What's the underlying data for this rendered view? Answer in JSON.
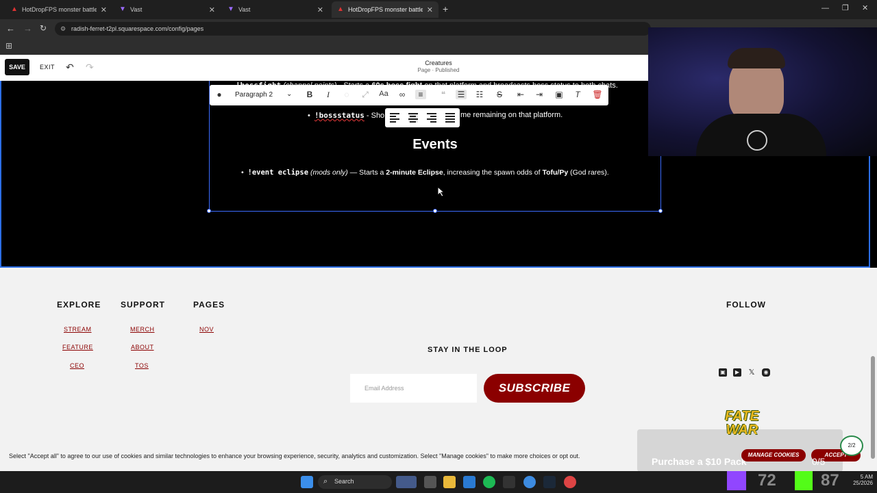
{
  "browser": {
    "tabs": [
      {
        "title": "HotDropFPS monster battle sty",
        "favicon": "squarespace-icon",
        "active": false
      },
      {
        "title": "Vast",
        "favicon": "vast-icon",
        "active": false
      },
      {
        "title": "Vast",
        "favicon": "vast-icon",
        "active": false
      },
      {
        "title": "HotDropFPS monster battle sty",
        "favicon": "squarespace-icon",
        "active": true
      }
    ],
    "url": "radish-ferret-t2pl.squarespace.com/config/pages"
  },
  "editor": {
    "save_label": "SAVE",
    "exit_label": "EXIT",
    "page_title": "Creatures",
    "page_status": "Page · Published"
  },
  "format_toolbar": {
    "style_select": "Paragraph 2"
  },
  "content": {
    "line1_cmd": "!bossfight",
    "line1_paren": "(channel points)",
    "line1_mid": " - Starts a ",
    "line1_bold": "60s boss fight",
    "line1_rest": " on that platform and broadcasts boss status to both chats.",
    "line2_cmd": "!bossstatus",
    "line2_a": " - Sho",
    "line2_b": "me remaining on that platform.",
    "events_heading": "Events",
    "event_cmd": "!event eclipse",
    "event_paren": "(mods only)",
    "event_mid": " — Starts a ",
    "event_bold1": "2-minute Eclipse",
    "event_mid2": ", increasing the spawn odds of ",
    "event_bold2": "Tofu/Py",
    "event_rest": " (God rares)."
  },
  "footer": {
    "explore": {
      "heading": "EXPLORE",
      "links": [
        "STREAM",
        "FEATURE",
        "CEO"
      ]
    },
    "support": {
      "heading": "SUPPORT",
      "links": [
        "MERCH",
        "ABOUT",
        "TOS"
      ]
    },
    "pages": {
      "heading": "PAGES",
      "links": [
        "NOV"
      ]
    },
    "follow_heading": "FOLLOW",
    "newsletter_heading": "STAY IN THE LOOP",
    "email_placeholder": "Email Address",
    "subscribe_label": "SUBSCRIBE",
    "social_icons": [
      "twitch-icon",
      "youtube-icon",
      "x-icon",
      "discord-icon"
    ]
  },
  "cookie_banner": {
    "text": "Select \"Accept all\" to agree to our use of cookies and similar technologies to enhance your browsing experience, security, analytics and customization. Select \"Manage cookies\" to make more choices or opt out.",
    "manage_label": "MANAGE COOKIES",
    "accept_label": "ACCEPT"
  },
  "overlay": {
    "logo_line1": "FATE",
    "logo_line2": "WAR",
    "promo_text": "Purchase a $10 Pack",
    "counter": "0/5",
    "badge": "2/2",
    "stat1": "72",
    "stat2": "87"
  },
  "taskbar": {
    "search_label": "Search",
    "time": "5 AM",
    "date": "25/2026"
  },
  "colors": {
    "accent": "#8b0000",
    "selection": "#3b6cff",
    "brand_dark": "#111111"
  }
}
